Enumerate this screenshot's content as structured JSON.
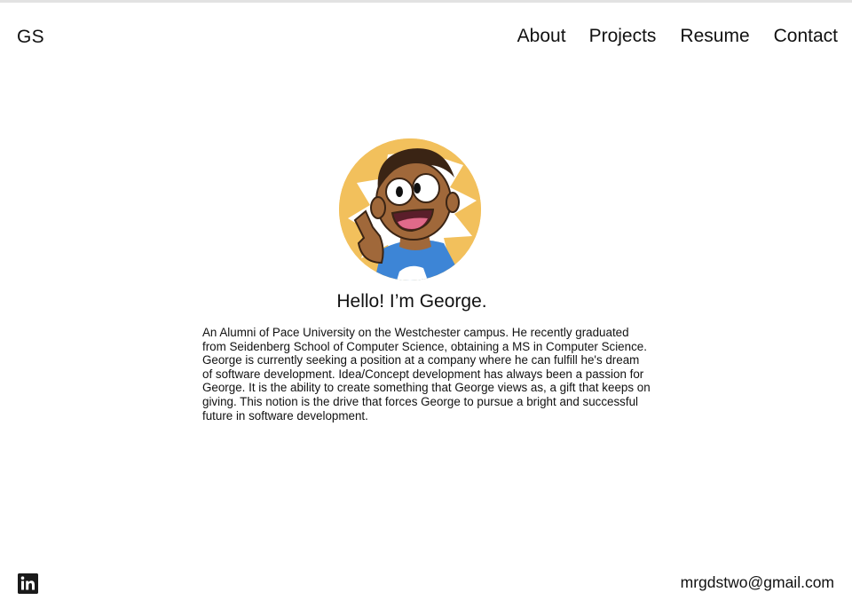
{
  "header": {
    "logo": "GS",
    "nav": [
      {
        "label": "About"
      },
      {
        "label": "Projects"
      },
      {
        "label": "Resume"
      },
      {
        "label": "Contact"
      }
    ]
  },
  "hero": {
    "greeting": "Hello! I’m George.",
    "bio": "An Alumni of Pace University on the Westchester campus. He recently graduated from Seidenberg School of Computer Science, obtaining a MS in Computer Science. George is currently seeking a position at a company where he can fulfill he's dream of software development. Idea/Concept development has always been a passion for George. It is the ability to create something that George views as, a gift that keeps on giving. This notion is the drive that forces George to pursue a bright and successful future in software development."
  },
  "footer": {
    "social_icon": "linkedin-icon",
    "email": "mrgdstwo@gmail.com"
  },
  "colors": {
    "avatar_background": "#f2c05c",
    "text": "#111111"
  }
}
